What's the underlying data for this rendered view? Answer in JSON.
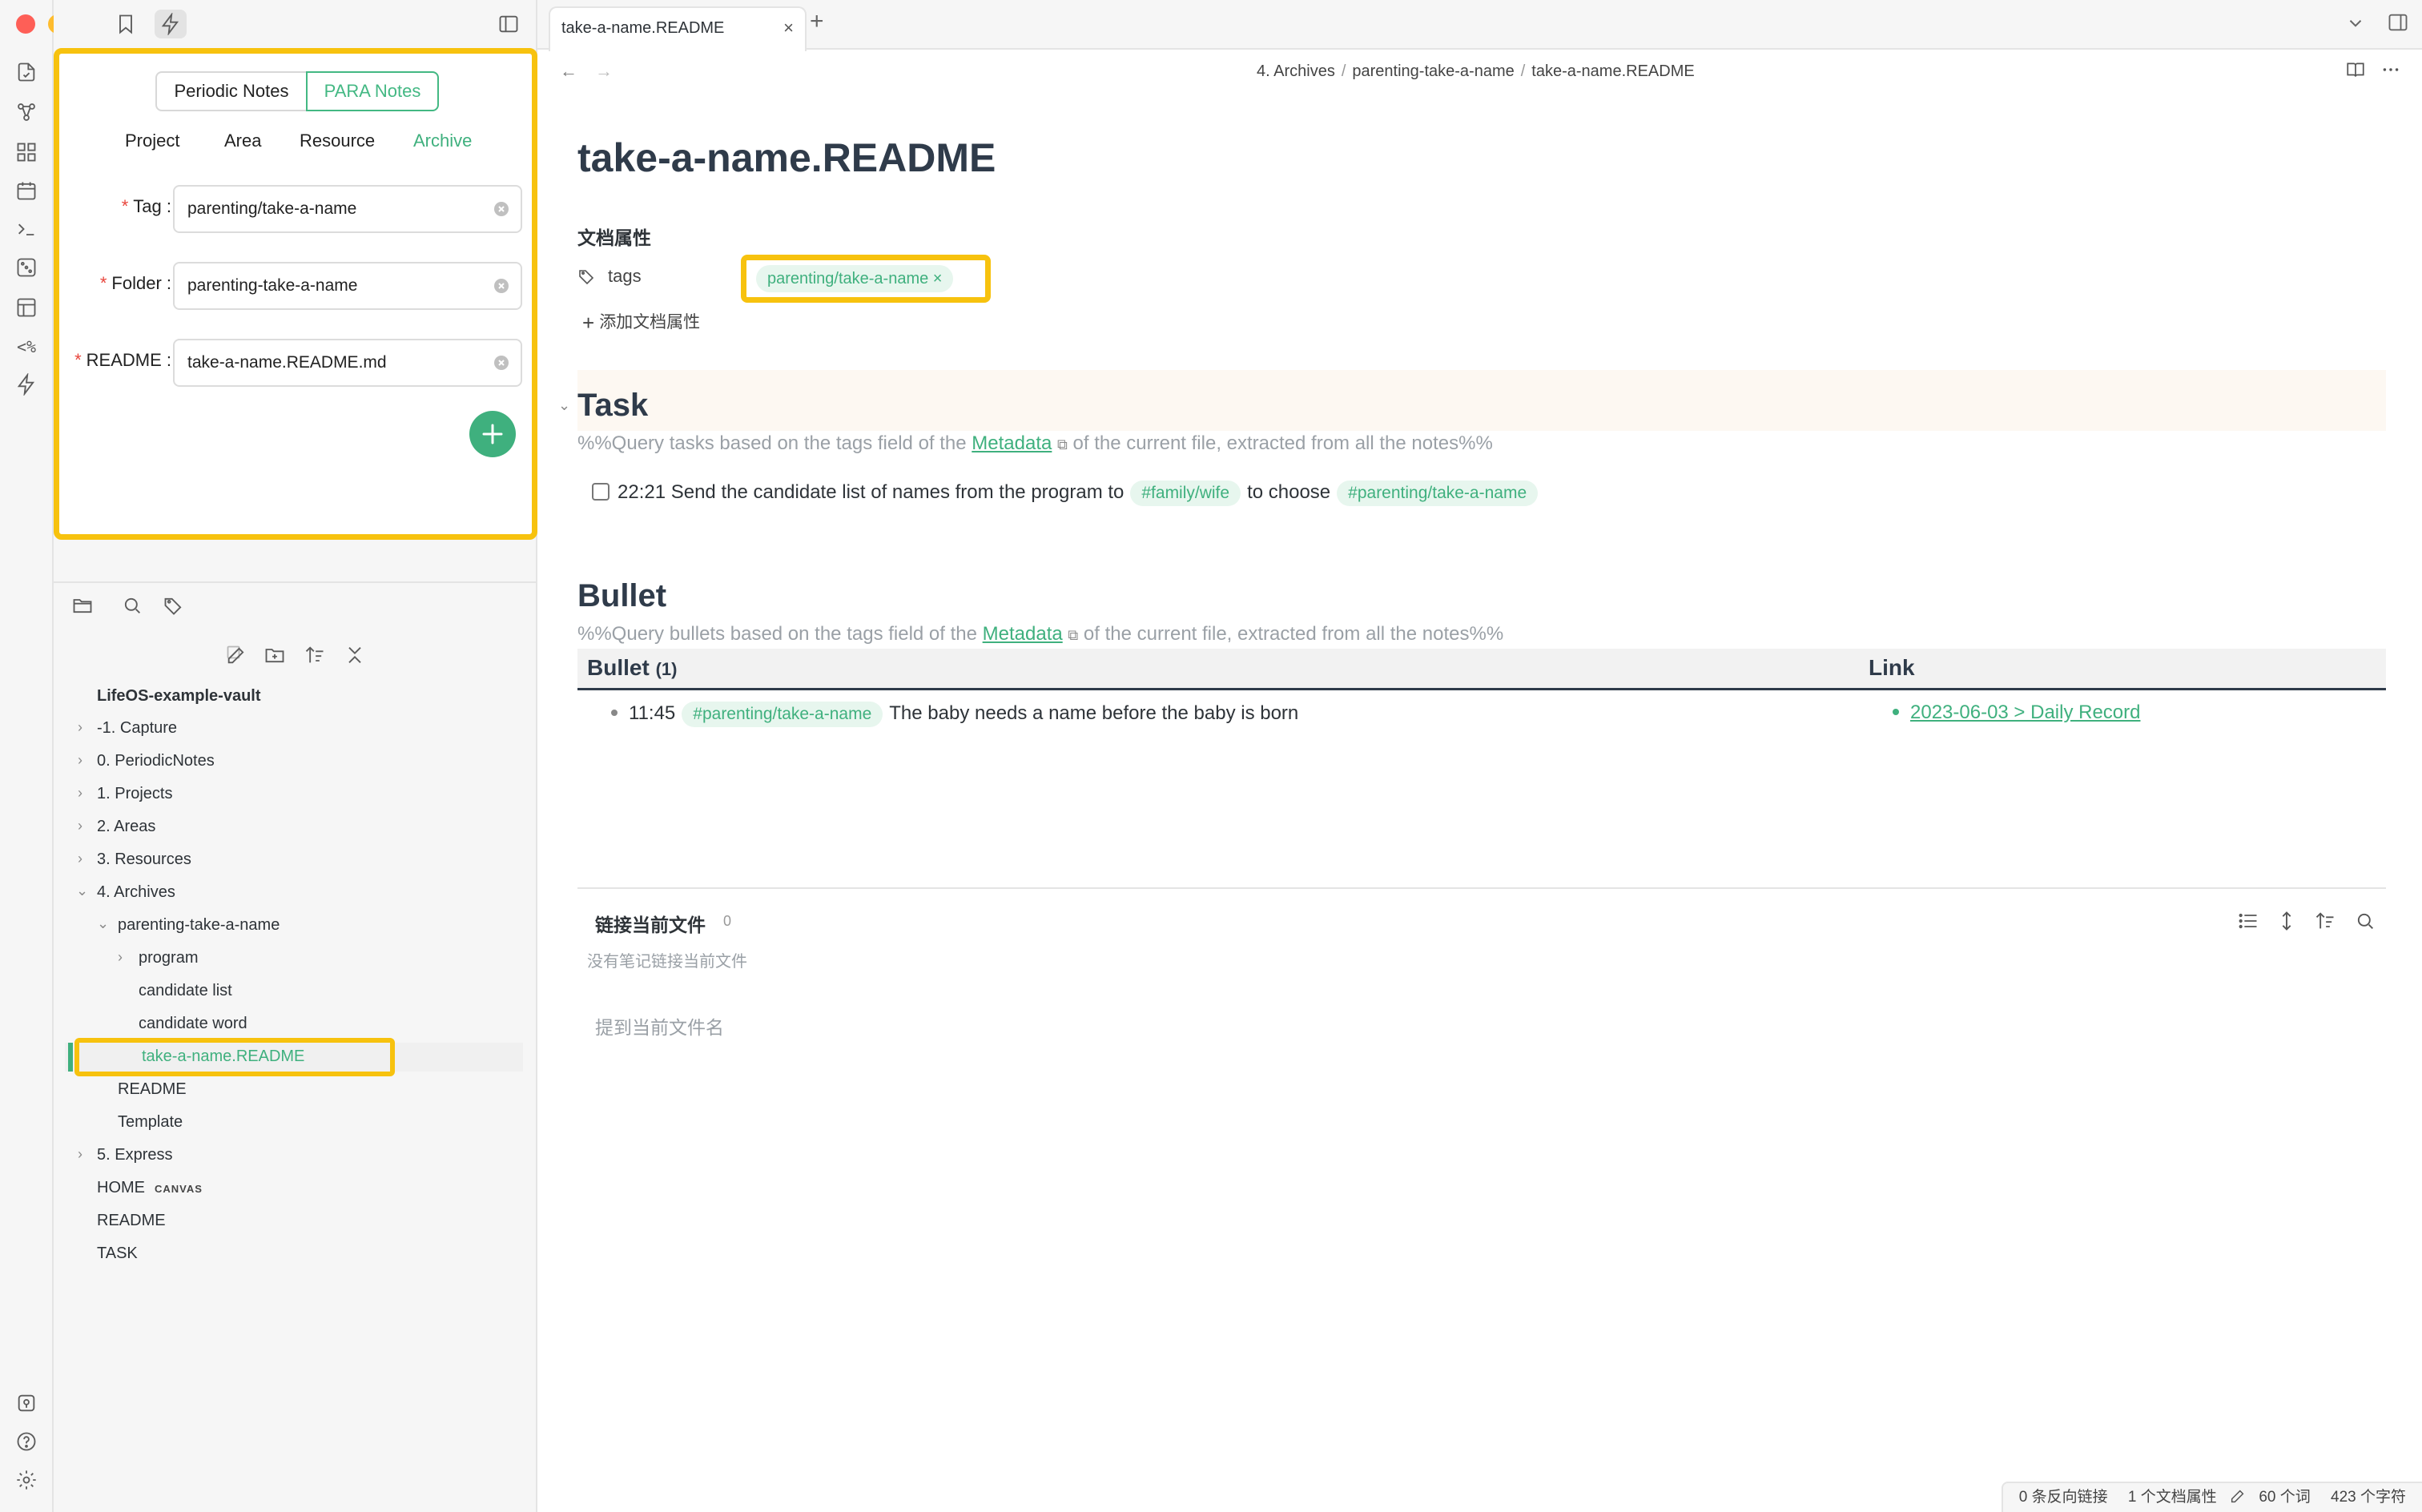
{
  "window": {
    "tab_title": "take-a-name.README",
    "tab_close": "×",
    "new_tab": "+"
  },
  "breadcrumb": [
    "4. Archives",
    "parenting-take-a-name",
    "take-a-name.README"
  ],
  "para_panel": {
    "segments": [
      "Periodic Notes",
      "PARA Notes"
    ],
    "active_segment": "PARA Notes",
    "tabs": [
      "Project",
      "Area",
      "Resource",
      "Archive"
    ],
    "active_tab": "Archive",
    "fields": [
      {
        "label": "Tag",
        "value": "parenting/take-a-name"
      },
      {
        "label": "Folder",
        "value": "parenting-take-a-name"
      },
      {
        "label": "README",
        "value": "take-a-name.README.md"
      }
    ],
    "required_mark": "*"
  },
  "file_tree": {
    "vault_name": "LifeOS-example-vault",
    "items": [
      {
        "label": "-1. Capture",
        "type": "folder",
        "expanded": false
      },
      {
        "label": "0. PeriodicNotes",
        "type": "folder",
        "expanded": false
      },
      {
        "label": "1. Projects",
        "type": "folder",
        "expanded": false
      },
      {
        "label": "2. Areas",
        "type": "folder",
        "expanded": false
      },
      {
        "label": "3. Resources",
        "type": "folder",
        "expanded": false
      },
      {
        "label": "4. Archives",
        "type": "folder",
        "expanded": true
      },
      {
        "label": "parenting-take-a-name",
        "type": "folder",
        "expanded": true
      },
      {
        "label": "program",
        "type": "folder",
        "expanded": false
      },
      {
        "label": "candidate list",
        "type": "file"
      },
      {
        "label": "candidate word",
        "type": "file"
      },
      {
        "label": "take-a-name.README",
        "type": "file",
        "active": true
      },
      {
        "label": "README",
        "type": "file"
      },
      {
        "label": "Template",
        "type": "file"
      },
      {
        "label": "5. Express",
        "type": "folder",
        "expanded": false
      },
      {
        "label": "HOME",
        "type": "file",
        "badge": "CANVAS"
      },
      {
        "label": "README",
        "type": "file"
      },
      {
        "label": "TASK",
        "type": "file"
      }
    ]
  },
  "document": {
    "title": "take-a-name.README",
    "properties_heading": "文档属性",
    "tags_label": "tags",
    "tag_value": "parenting/take-a-name",
    "tag_remove": "×",
    "add_property": "添加文档属性",
    "task_section": {
      "heading": "Task",
      "comment_before": "%%Query tasks based on the tags field of the ",
      "comment_link": "Metadata",
      "comment_after": " of the current file, extracted from all the notes%%",
      "task_text_1": "22:21 Send the candidate list of names from the program to",
      "task_tag_1": "#family/wife",
      "task_text_2": "to choose",
      "task_tag_2": "#parenting/take-a-name",
      "checked": false
    },
    "bullet_section": {
      "heading": "Bullet",
      "comment_before": "%%Query bullets based on the tags field of the ",
      "comment_link": "Metadata",
      "comment_after": " of the current file, extracted from all the notes%%",
      "col_bullet": "Bullet",
      "col_bullet_count": "(1)",
      "col_link": "Link",
      "row_time": "11:45",
      "row_tag": "#parenting/take-a-name",
      "row_text": "The baby needs a name before the baby is born",
      "row_link": "2023-06-03 > Daily Record"
    }
  },
  "backlinks": {
    "title": "链接当前文件",
    "count": "0",
    "empty": "没有笔记链接当前文件",
    "mentions_title": "提到当前文件名"
  },
  "status_bar": {
    "backlinks": "0 条反向链接",
    "properties": "1 个文档属性",
    "words": "60 个词",
    "chars": "423 个字符"
  },
  "colors": {
    "accent": "#3fb07e",
    "highlight": "#f7c20e"
  }
}
